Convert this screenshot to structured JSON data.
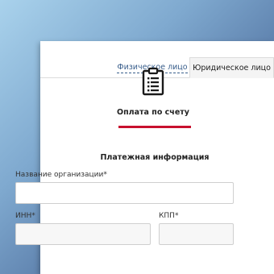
{
  "tabs": [
    {
      "label": "Физическое лицо",
      "active": false
    },
    {
      "label": "Юридическое лицо",
      "active": true
    }
  ],
  "payment_method": {
    "label": "Оплата по счету",
    "icon": "clipboard-icon",
    "underline_color": "#c8102e"
  },
  "section_title": "Платежная информация",
  "fields": {
    "organization": {
      "label": "Название организации",
      "required_mark": "*",
      "value": ""
    },
    "inn": {
      "label": "ИНН",
      "required_mark": "*",
      "value": ""
    },
    "kpp": {
      "label": "КПП",
      "required_mark": "*",
      "value": ""
    }
  }
}
